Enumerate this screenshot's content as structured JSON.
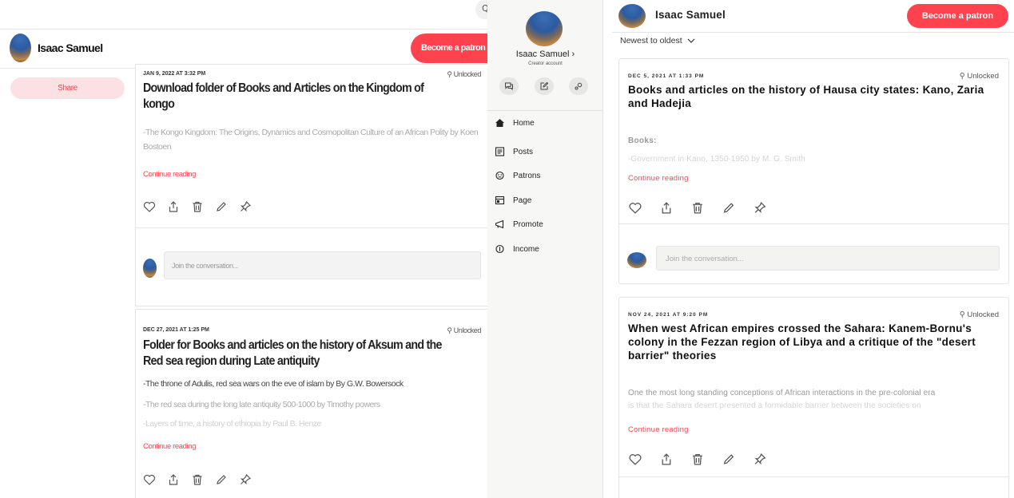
{
  "left": {
    "search_glyph": "Q",
    "creator_name": "Isaac Samuel",
    "become_patron": "Become a patron",
    "share": "Share",
    "posts": [
      {
        "date": "JAN 9, 2022 AT 3:32 PM",
        "unlocked": "Unlocked",
        "title": "Download folder of Books and Articles on the Kingdom of kongo",
        "paragraphs": [
          "-The Kongo Kingdom: The Origins, Dynamics and Cosmopolitan Culture of an African Polity  by Koen Bostoen"
        ],
        "continue": "Continue reading",
        "comment_placeholder": "Join the conversation..."
      },
      {
        "date": "DEC 27, 2021 AT 1:25 PM",
        "unlocked": "Unlocked",
        "title": "Folder for Books and articles on the history of Aksum and the Red sea region during Late antiquity",
        "paragraphs": [
          "-The throne of Adulis, red sea wars on the eve of islam by By G.W. Bowersock",
          "-The red sea during the long late antiquity 500-1000 by Timothy powers",
          "-Layers of time, a history of ethiopia by Paul B. Henze"
        ],
        "continue": "Continue reading"
      }
    ]
  },
  "nav": {
    "creator_name": "Isaac Samuel",
    "chevron": "›",
    "account_type": "Creator account",
    "items": [
      {
        "label": "Home",
        "icon": "home-icon"
      },
      {
        "label": "Posts",
        "icon": "posts-icon"
      },
      {
        "label": "Patrons",
        "icon": "patrons-icon"
      },
      {
        "label": "Page",
        "icon": "page-icon"
      },
      {
        "label": "Promote",
        "icon": "megaphone-icon"
      },
      {
        "label": "Income",
        "icon": "income-icon"
      }
    ]
  },
  "right": {
    "creator_name": "Isaac Samuel",
    "become_patron": "Become a patron",
    "sort": "Newest to oldest",
    "posts": [
      {
        "date": "DEC 5, 2021 AT 1:33 PM",
        "unlocked": "Unlocked",
        "title": "Books and articles on the history of Hausa city states: Kano, Zaria and Hadejia",
        "section_label": "Books:",
        "paragraphs": [
          "-Government in Kano, 1350-1950 by M. G. Smith"
        ],
        "continue": "Continue reading",
        "comment_placeholder": "Join the conversation..."
      },
      {
        "date": "NOV 24, 2021 AT 9:20 PM",
        "unlocked": "Unlocked",
        "title": "When west African empires crossed the Sahara: Kanem-Bornu's colony in the Fezzan region of Libya and a critique of the \"desert barrier\" theories",
        "paragraphs": [
          "One the most long standing conceptions of African interactions in the pre-colonial era",
          "is that the Sahara desert presented a formidable barrier between the societies on"
        ],
        "continue": "Continue reading"
      }
    ]
  },
  "colors": {
    "brand": "#ff424d",
    "share_bg": "#fbe1e4",
    "nav_bg": "#f7f7f5"
  }
}
